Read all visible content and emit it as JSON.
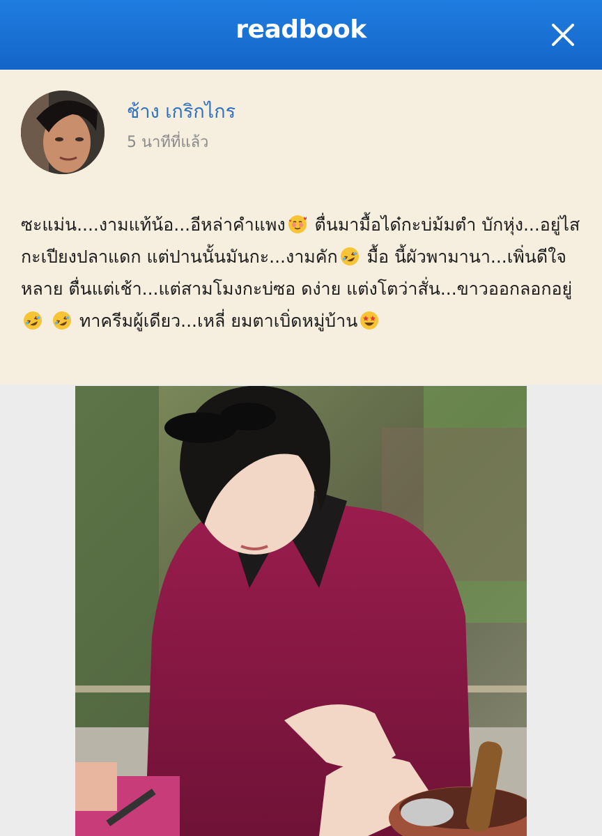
{
  "header": {
    "brand": "readbook",
    "close_icon": "close-icon",
    "color": "#1a72d6"
  },
  "post": {
    "author": "ช้าง เกริกไกร",
    "timestamp": "5 นาทีที่แล้ว",
    "background": "#f6efdf",
    "segments": [
      "ซะแม่น....งามแท้น้อ...อีหล่าคำแพง",
      " ตื่นมามื้อได๋กะบ่ม้มตำ บักหุ่ง...อยู่ไสกะเปียงปลาแดก แต่ปานนั้นมันกะ...งามคัก",
      " มื้อ นี้ผัวพามานา...เพิ่นดีใจหลาย ตื่นแต่เช้า...แต่สามโมงกะบ่ซอ ดง่าย แต่งโตว่าสั่น...ขาวออกลอกอยู่",
      " ",
      " ทาครีมผู้เดียว...เหลี่ ยมตาเบิ่ดหมู่บ้าน"
    ],
    "emojis": [
      "smiling-face-with-hearts",
      "rolling-on-floor-laughing",
      "rolling-on-floor-laughing",
      "rolling-on-floor-laughing",
      "star-struck"
    ]
  }
}
